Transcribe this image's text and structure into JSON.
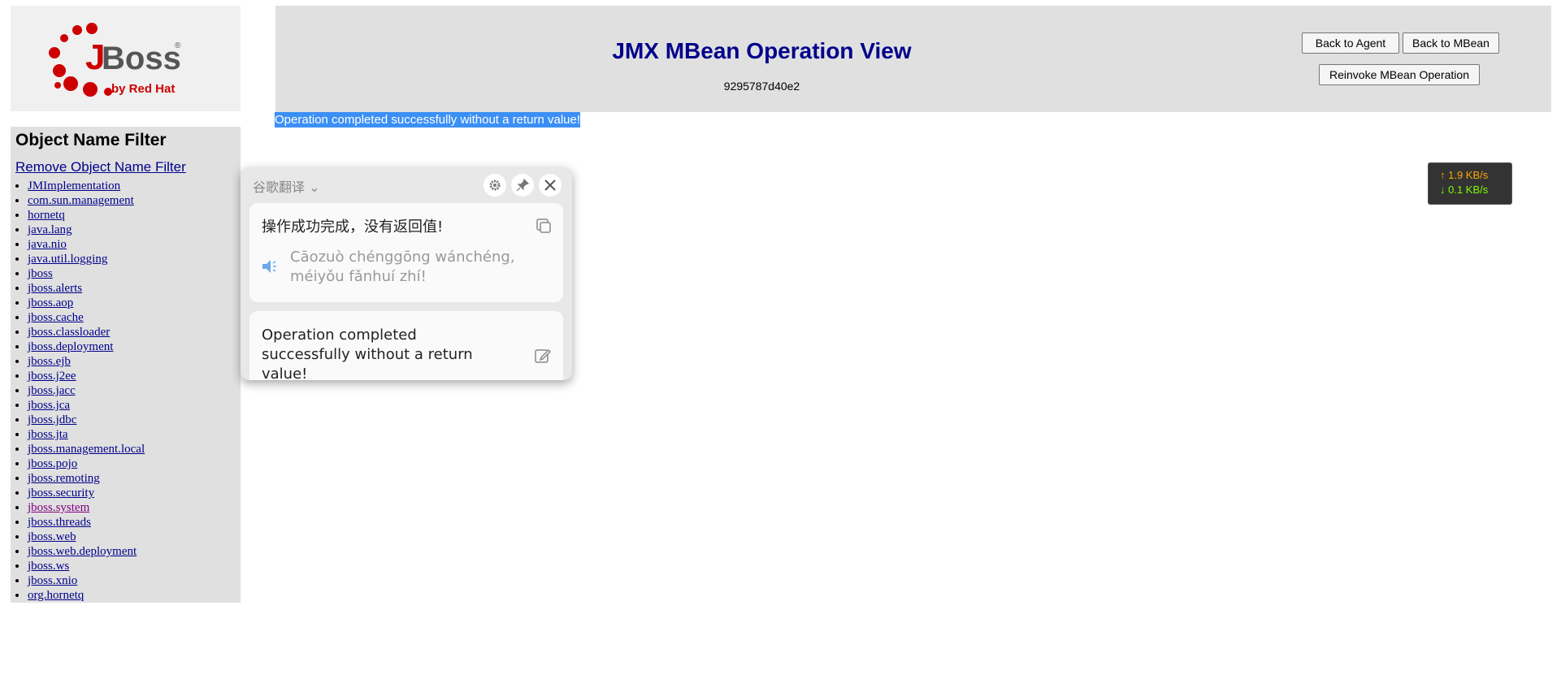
{
  "logo": {
    "brand": "JBoss",
    "byline": "by Red Hat",
    "mark": "®"
  },
  "sidebar": {
    "heading": "Object Name Filter",
    "remove_link": "Remove Object Name Filter",
    "domains": [
      "JMImplementation",
      "com.sun.management",
      "hornetq",
      "java.lang",
      "java.nio",
      "java.util.logging",
      "jboss",
      "jboss.alerts",
      "jboss.aop",
      "jboss.cache",
      "jboss.classloader",
      "jboss.deployment",
      "jboss.ejb",
      "jboss.j2ee",
      "jboss.jacc",
      "jboss.jca",
      "jboss.jdbc",
      "jboss.jta",
      "jboss.management.local",
      "jboss.pojo",
      "jboss.remoting",
      "jboss.security",
      "jboss.system",
      "jboss.threads",
      "jboss.web",
      "jboss.web.deployment",
      "jboss.ws",
      "jboss.xnio",
      "org.hornetq"
    ],
    "visited_domain": "jboss.system"
  },
  "header": {
    "title": "JMX MBean Operation View",
    "subtitle": "9295787d40e2",
    "back_agent": "Back to Agent",
    "back_mbean": "Back to MBean",
    "reinvoke": "Reinvoke MBean Operation"
  },
  "status_message": "Operation completed successfully without a return value!",
  "netspeed": {
    "up": "↑ 1.9 KB/s",
    "down": "↓ 0.1 KB/s"
  },
  "translator": {
    "service": "谷歌翻译 ⌄",
    "source_text": "操作成功完成，没有返回值!",
    "pinyin": "Cāozuò chénggōng wánchéng, méiyǒu fǎnhuí zhí!",
    "translation": "Operation completed successfully without a return value!"
  },
  "colors": {
    "link": "#00008b",
    "visited": "#800080",
    "panel": "#e0e0e0",
    "selection": "#3b8ff5"
  }
}
